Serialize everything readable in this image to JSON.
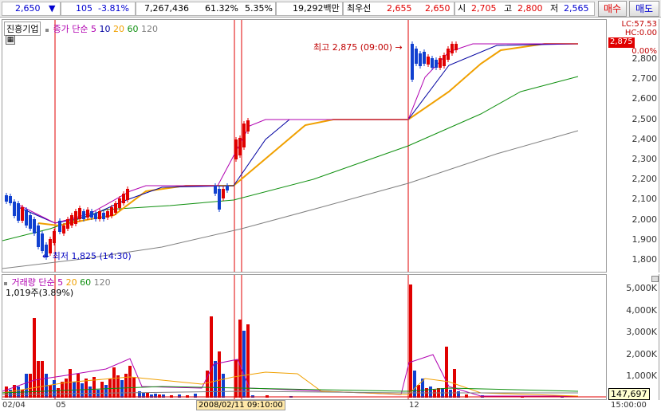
{
  "toolbar": {
    "price": "2,650",
    "change": "105",
    "change_pct": "-3.81%",
    "volume": "7,267,436",
    "ratio1": "61.32%",
    "ratio2": "5.35%",
    "amount": "19,292백만",
    "priority_label": "최우선",
    "ask": "2,655",
    "bid": "2,650",
    "open_label": "시",
    "open": "2,705",
    "high_label": "고",
    "high": "2,800",
    "low_label": "저",
    "low": "2,565",
    "buy_label": "매수",
    "sell_label": "매도"
  },
  "price_pane": {
    "stock_name": "진흥기업",
    "ma_label": "종가 단순",
    "ma_periods": [
      "5",
      "10",
      "20",
      "60",
      "120"
    ],
    "lc_label": "LC:57.53",
    "hc_label": "HC:0.00",
    "current_price_box": "2,875",
    "pct_label": "0.00%",
    "high_annotation": "최고 2,875 (09:00)",
    "low_annotation": "최저 1,825 (14:30)",
    "y_labels": [
      "2,800",
      "2,700",
      "2,600",
      "2,500",
      "2,400",
      "2,300",
      "2,200",
      "2,100",
      "2,000",
      "1,900",
      "1,800"
    ]
  },
  "volume_pane": {
    "legend_label": "거래량",
    "ma_label": "단순",
    "ma_periods": [
      "5",
      "20",
      "60",
      "120"
    ],
    "current_volume": "1,019주(3.89%)",
    "y_labels": [
      "5,000K",
      "4,000K",
      "3,000K",
      "2,000K",
      "1,000K"
    ],
    "last_volume_box": "147,697"
  },
  "x_axis": {
    "ticks": [
      "02/04",
      "05",
      "12",
      "15:00:00"
    ],
    "crosshair_time": "2008/02/11 09:10:00"
  },
  "colors": {
    "up": "#e00000",
    "down": "#1040d0",
    "ma5": "#b000b0",
    "ma10": "#0000a0",
    "ma20": "#f0a000",
    "ma60": "#109010",
    "ma120": "#808080"
  }
}
